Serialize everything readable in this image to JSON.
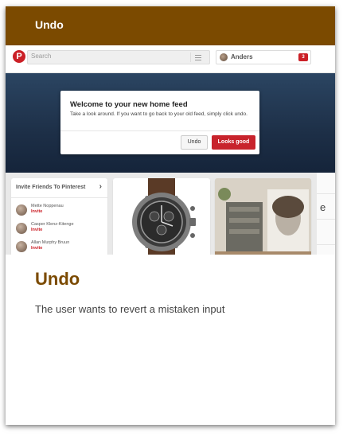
{
  "card": {
    "header_title": "Undo",
    "title": "Undo",
    "description": "The user wants to revert a mistaken input"
  },
  "screenshot": {
    "logo_letter": "P",
    "search_placeholder": "Search",
    "user_name": "Anders",
    "notification_count": "3",
    "dialog": {
      "title": "Welcome to your new home feed",
      "body": "Take a look around. If you want to go back to your old feed, simply click undo.",
      "undo_label": "Undo",
      "confirm_label": "Looks good"
    },
    "invite_panel": {
      "title": "Invite Friends To Pinterest",
      "friends": [
        {
          "name": "Mette Noppenau",
          "action": "Invite"
        },
        {
          "name": "Casper Klenz-Kitenge",
          "action": "Invite"
        },
        {
          "name": "Allan Murphy Bruun",
          "action": "Invite"
        }
      ]
    },
    "side_letter": "e"
  },
  "colors": {
    "brand_brown": "#7b4a00",
    "pinterest_red": "#cb2027",
    "hero_blue": "#1d2f47"
  },
  "icons": [
    "pinterest-logo-icon",
    "menu-icon",
    "avatar",
    "notification-badge",
    "chevron-right-icon"
  ]
}
